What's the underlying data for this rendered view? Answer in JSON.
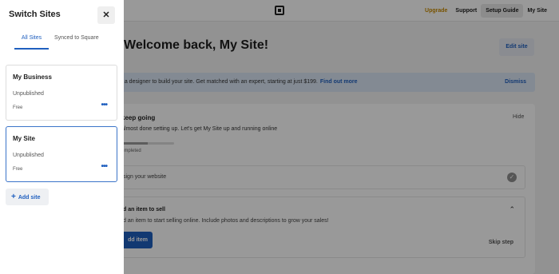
{
  "drawer": {
    "title": "Switch Sites",
    "close_icon": "close-icon",
    "tabs": [
      {
        "label": "All Sites"
      },
      {
        "label": "Synced to Square"
      }
    ],
    "sites": [
      {
        "name": "My Business",
        "status": "Unpublished",
        "plan": "Free",
        "more": "•••"
      },
      {
        "name": "My Site",
        "status": "Unpublished",
        "plan": "Free",
        "more": "•••"
      }
    ],
    "add_site_label": "Add site",
    "add_icon": "plus-icon"
  },
  "topbar": {
    "logo_icon": "square-logo-icon",
    "upgrade": "Upgrade",
    "support": "Support",
    "setup_guide": "Setup Guide",
    "my_site": "My Site"
  },
  "main": {
    "welcome": "Welcome back, My Site!",
    "edit_site": "Edit site",
    "banner": {
      "text": "e a designer to build your site. Get matched with an expert, starting at just $199.",
      "link": "Find out more",
      "dismiss": "Dismiss"
    },
    "setup": {
      "title": "keep going",
      "hide": "Hide",
      "subtitle": "almost done setting up. Let's get My Site up and running online",
      "progress": 0.5,
      "completed": "ompleted"
    },
    "tasks": [
      {
        "label": "sign your website",
        "icon": "check-circle-icon"
      },
      {
        "label": "d an item to sell",
        "description": "d an item to start selling online. Include photos and descriptions to grow your sales!",
        "button": "dd item",
        "skip": "Skip step",
        "icon": "chevron-up-icon"
      }
    ]
  },
  "colors": {
    "accent": "#1f5fbf",
    "overlay": "rgba(0,0,0,0.4)",
    "upgrade": "#c98a00"
  }
}
